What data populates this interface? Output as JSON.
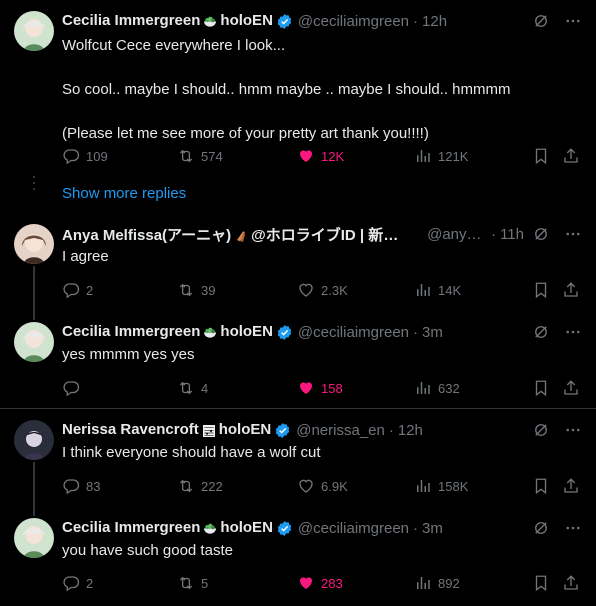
{
  "colors": {
    "bg": "#000000",
    "text": "#e7e9ea",
    "muted": "#71767b",
    "accent": "#1d9bf0",
    "like": "#f91880",
    "divider": "#2f3336"
  },
  "show_more": "Show more replies",
  "tweets": [
    {
      "name": "Cecilia Immergreen",
      "emoji_name": "salad-bowl-icon",
      "name_suffix": "holoEN",
      "verified": true,
      "handle": "@ceciliaimgreen",
      "time": "12h",
      "lines": [
        "Wolfcut Cece everywhere I look...",
        "",
        "So cool.. maybe I should.. hmm maybe .. maybe I should.. hmmmm",
        "",
        "(Please let me see more of your pretty art thank you!!!!)"
      ],
      "replies": "109",
      "retweets": "574",
      "likes": "12K",
      "liked": true,
      "views": "121K"
    },
    {
      "name": "Anya Melfissa(アーニャ)",
      "emoji_name": "dagger-icon",
      "name_suffix": "@ホロライブID | 新曲...",
      "verified": false,
      "handle": "@anya...",
      "time": "11h",
      "lines": [
        "I agree"
      ],
      "replies": "2",
      "retweets": "39",
      "likes": "2.3K",
      "liked": false,
      "views": "14K"
    },
    {
      "name": "Cecilia Immergreen",
      "emoji_name": "salad-bowl-icon",
      "name_suffix": "holoEN",
      "verified": true,
      "handle": "@ceciliaimgreen",
      "time": "3m",
      "lines": [
        "yes mmmm yes yes"
      ],
      "replies": "",
      "retweets": "4",
      "likes": "158",
      "liked": true,
      "views": "632"
    },
    {
      "name": "Nerissa Ravencroft",
      "emoji_name": "music-score-icon",
      "name_suffix": "holoEN",
      "verified": true,
      "handle": "@nerissa_en",
      "time": "12h",
      "lines": [
        "I think everyone should have a wolf cut"
      ],
      "replies": "83",
      "retweets": "222",
      "likes": "6.9K",
      "liked": false,
      "views": "158K"
    },
    {
      "name": "Cecilia Immergreen",
      "emoji_name": "salad-bowl-icon",
      "name_suffix": "holoEN",
      "verified": true,
      "handle": "@ceciliaimgreen",
      "time": "3m",
      "lines": [
        "you have such good taste"
      ],
      "replies": "2",
      "retweets": "5",
      "likes": "283",
      "liked": true,
      "views": "892"
    }
  ]
}
